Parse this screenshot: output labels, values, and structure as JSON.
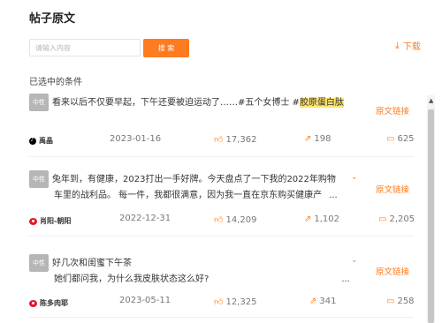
{
  "page_title": "帖子原文",
  "search": {
    "placeholder": "请输入内容",
    "button_label": "搜 索"
  },
  "download_label": "下载",
  "selected_conditions_label": "已选中的条件",
  "posts": [
    {
      "badge": "中性",
      "line1_prefix": "看来以后不仅要早起，下午还要被迫运动了……#五个女博士 #",
      "line1_highlight": "胶原蛋白肽",
      "line2": "",
      "orig_link": "原文链接",
      "platform": "douyin",
      "author": "禹晶",
      "date": "2023-01-16",
      "likes": "17,362",
      "shares": "198",
      "comments": "625"
    },
    {
      "badge": "中性",
      "line1_prefix": "兔年到，有健康，2023打出一手好牌。今天盘点了一下我的2022年购物",
      "line1_highlight": "",
      "line2": "车里的战利品。 每一件，我都很满意，因为我一直在京东购买健康产",
      "line2_more": "...",
      "orig_link": "原文链接",
      "platform": "weibo",
      "author": "肖阳-朝阳",
      "date": "2022-12-31",
      "likes": "14,209",
      "shares": "1,102",
      "comments": "2,205"
    },
    {
      "badge": "中性",
      "line1_prefix": "好几次和闺蜜下午茶",
      "line1_highlight": "",
      "line2": "她们都问我，为什么我皮肤状态这么好?",
      "line2_more": "...",
      "orig_link": "原文链接",
      "platform": "weibo",
      "author": "陈多肉耶",
      "date": "2023-05-11",
      "likes": "12,325",
      "shares": "341",
      "comments": "258"
    }
  ],
  "colors": {
    "accent": "#ff7b1f",
    "badge": "#b6b6b6",
    "highlight": "#ffe36b"
  }
}
